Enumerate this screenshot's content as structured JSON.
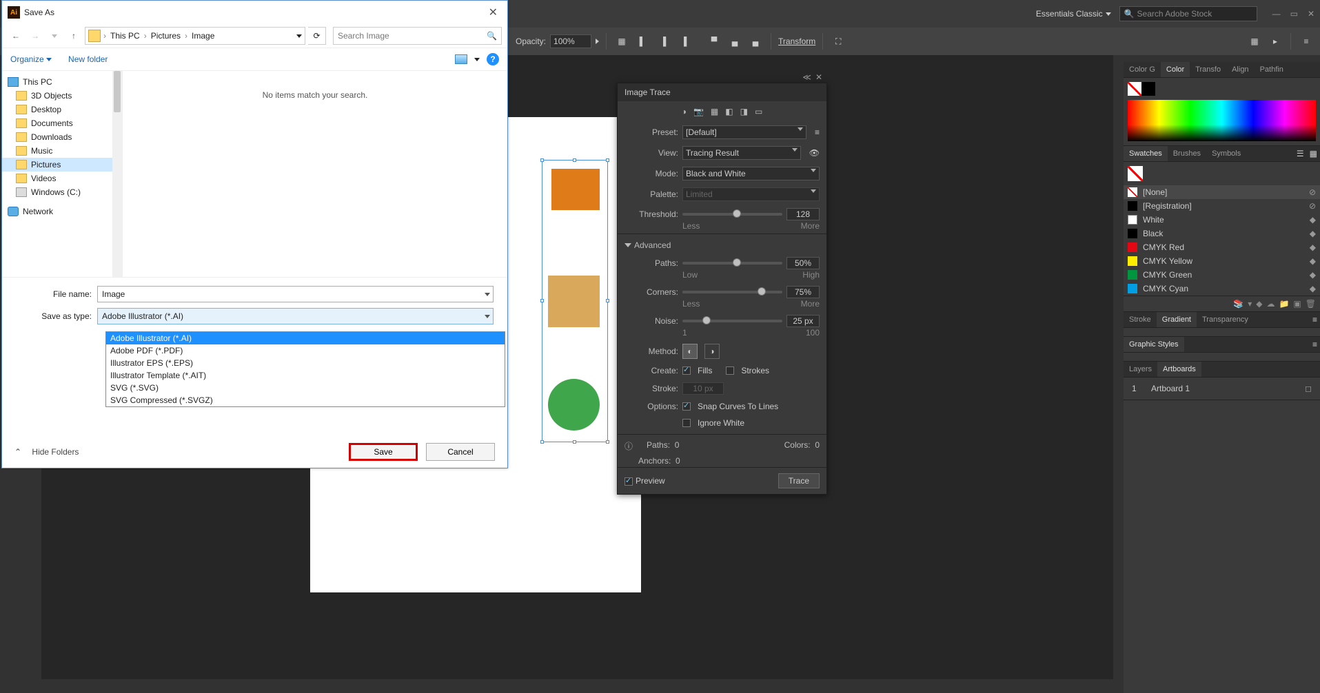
{
  "topbar": {
    "workspace": "Essentials Classic",
    "search_placeholder": "Search Adobe Stock"
  },
  "options_bar": {
    "opacity_label": "Opacity:",
    "opacity_value": "100%",
    "transform_label": "Transform"
  },
  "saveas": {
    "title": "Save As",
    "breadcrumbs": [
      "This PC",
      "Pictures",
      "Image"
    ],
    "search_placeholder": "Search Image",
    "organize": "Organize",
    "newfolder": "New folder",
    "empty_msg": "No items match your search.",
    "tree": [
      "This PC",
      "3D Objects",
      "Desktop",
      "Documents",
      "Downloads",
      "Music",
      "Pictures",
      "Videos",
      "Windows (C:)",
      "Network"
    ],
    "tree_selected_index": 6,
    "filename_label": "File name:",
    "filename_value": "Image",
    "type_label": "Save as type:",
    "type_value": "Adobe Illustrator (*.AI)",
    "type_options": [
      "Adobe Illustrator (*.AI)",
      "Adobe PDF (*.PDF)",
      "Illustrator EPS (*.EPS)",
      "Illustrator Template (*.AIT)",
      "SVG (*.SVG)",
      "SVG Compressed (*.SVGZ)"
    ],
    "type_selected_index": 0,
    "hide_folders": "Hide Folders",
    "save": "Save",
    "cancel": "Cancel"
  },
  "trace": {
    "title": "Image Trace",
    "preset_label": "Preset:",
    "preset_value": "[Default]",
    "view_label": "View:",
    "view_value": "Tracing Result",
    "mode_label": "Mode:",
    "mode_value": "Black and White",
    "palette_label": "Palette:",
    "palette_value": "Limited",
    "threshold_label": "Threshold:",
    "threshold_value": "128",
    "threshold_min": "Less",
    "threshold_max": "More",
    "advanced": "Advanced",
    "paths_label": "Paths:",
    "paths_value": "50%",
    "paths_min": "Low",
    "paths_max": "High",
    "corners_label": "Corners:",
    "corners_value": "75%",
    "corners_min": "Less",
    "corners_max": "More",
    "noise_label": "Noise:",
    "noise_value": "25 px",
    "noise_min": "1",
    "noise_max": "100",
    "method_label": "Method:",
    "create_label": "Create:",
    "fills": "Fills",
    "strokes": "Strokes",
    "stroke_label": "Stroke:",
    "stroke_value": "10 px",
    "options_label": "Options:",
    "snap": "Snap Curves To Lines",
    "ignore": "Ignore White",
    "info_paths_label": "Paths:",
    "info_paths_val": "0",
    "info_colors_label": "Colors:",
    "info_colors_val": "0",
    "info_anchors_label": "Anchors:",
    "info_anchors_val": "0",
    "preview": "Preview",
    "trace_btn": "Trace"
  },
  "panels": {
    "color_tabs": [
      "Color G",
      "Color",
      "Transfo",
      "Align",
      "Pathfin"
    ],
    "swatch_tabs": [
      "Swatches",
      "Brushes",
      "Symbols"
    ],
    "swatches": [
      {
        "name": "[None]",
        "color": "none"
      },
      {
        "name": "[Registration]",
        "color": "#000"
      },
      {
        "name": "White",
        "color": "#fff"
      },
      {
        "name": "Black",
        "color": "#000"
      },
      {
        "name": "CMYK Red",
        "color": "#e30613"
      },
      {
        "name": "CMYK Yellow",
        "color": "#ffed00"
      },
      {
        "name": "CMYK Green",
        "color": "#009640"
      },
      {
        "name": "CMYK Cyan",
        "color": "#009fe3"
      }
    ],
    "stroke_tabs": [
      "Stroke",
      "Gradient",
      "Transparency"
    ],
    "gstyles": "Graphic Styles",
    "layer_tabs": [
      "Layers",
      "Artboards"
    ],
    "artboard_row_num": "1",
    "artboard_row_name": "Artboard 1"
  }
}
